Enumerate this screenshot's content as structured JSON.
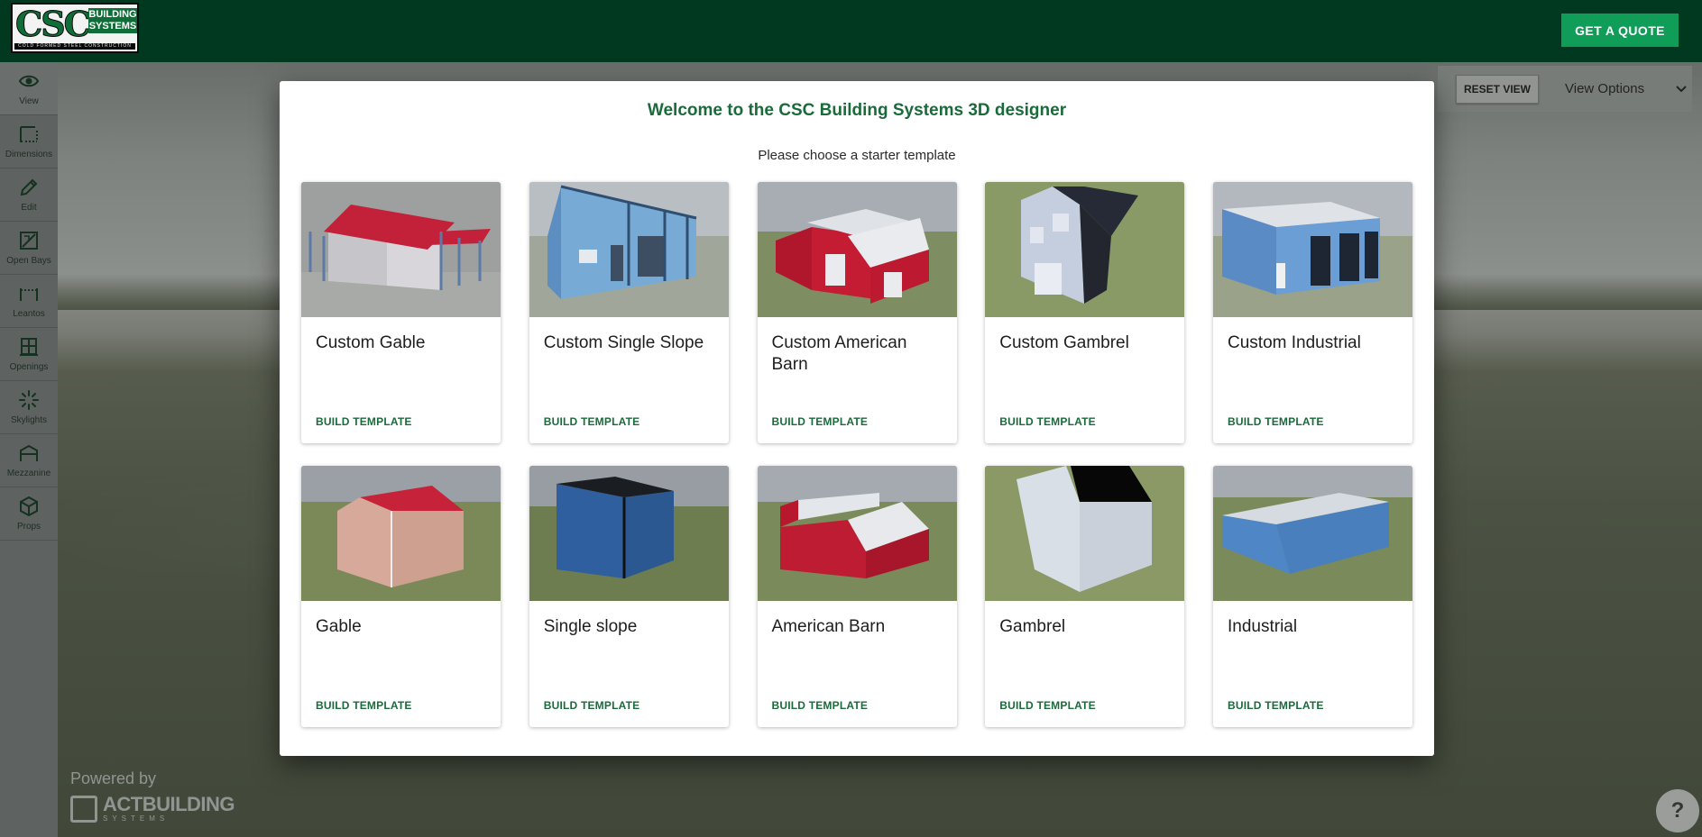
{
  "header": {
    "logo_csc": "CSC",
    "logo_building": "BUILDING SYSTEMS",
    "logo_tagline": "COLD FORMED STEEL CONSTRUCTION",
    "quote_button": "GET A QUOTE"
  },
  "sidebar": {
    "items": [
      {
        "label": "View",
        "icon": "eye-icon"
      },
      {
        "label": "Dimensions",
        "icon": "dimensions-icon"
      },
      {
        "label": "Edit",
        "icon": "pencil-icon"
      },
      {
        "label": "Open Bays",
        "icon": "open-bay-icon"
      },
      {
        "label": "Leantos",
        "icon": "leanto-icon"
      },
      {
        "label": "Openings",
        "icon": "window-icon"
      },
      {
        "label": "Skylights",
        "icon": "skylight-icon"
      },
      {
        "label": "Mezzanine",
        "icon": "mezzanine-icon"
      },
      {
        "label": "Props",
        "icon": "cube-icon"
      }
    ]
  },
  "view_controls": {
    "reset_label": "RESET VIEW",
    "options_label": "View Options"
  },
  "footer": {
    "powered_by": "Powered by",
    "act_name": "ACTBUILDING",
    "act_sub": "SYSTEMS"
  },
  "help": {
    "label": "?"
  },
  "modal": {
    "title": "Welcome to the CSC Building Systems 3D designer",
    "subtitle": "Please choose a starter template",
    "templates": [
      {
        "name": "Custom Gable",
        "button": "BUILD TEMPLATE"
      },
      {
        "name": "Custom Single Slope",
        "button": "BUILD TEMPLATE"
      },
      {
        "name": "Custom American Barn",
        "button": "BUILD TEMPLATE"
      },
      {
        "name": "Custom Gambrel",
        "button": "BUILD TEMPLATE"
      },
      {
        "name": "Custom Industrial",
        "button": "BUILD TEMPLATE"
      },
      {
        "name": "Gable",
        "button": "BUILD TEMPLATE"
      },
      {
        "name": "Single slope",
        "button": "BUILD TEMPLATE"
      },
      {
        "name": "American Barn",
        "button": "BUILD TEMPLATE"
      },
      {
        "name": "Gambrel",
        "button": "BUILD TEMPLATE"
      },
      {
        "name": "Industrial",
        "button": "BUILD TEMPLATE"
      }
    ]
  },
  "colors": {
    "header_bg": "#00391f",
    "accent_green": "#1b6a3b",
    "quote_btn": "#0f9d58"
  }
}
